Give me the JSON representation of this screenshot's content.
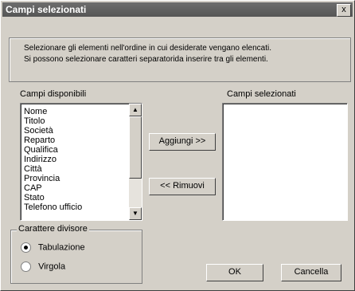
{
  "window": {
    "title": "Campi selezionati",
    "close_glyph": "x"
  },
  "info": {
    "line1": "Selezionare gli elementi nell'ordine in cui desiderate vengano elencati.",
    "line2": "Si possono selezionare caratteri separatorida inserire tra gli elementi."
  },
  "available": {
    "label": "Campi disponibili",
    "items": [
      "Nome",
      "Titolo",
      "Società",
      "Reparto",
      "Qualifica",
      "Indirizzo",
      "Città",
      "Provincia",
      "CAP",
      "Stato",
      "Telefono ufficio"
    ]
  },
  "selected": {
    "label": "Campi selezionati",
    "items": []
  },
  "buttons": {
    "add": "Aggiungi >>",
    "remove": "<< Rimuovi",
    "ok": "OK",
    "cancel": "Cancella"
  },
  "separator": {
    "title": "Carattere divisore",
    "options": [
      {
        "label": "Tabulazione",
        "selected": true
      },
      {
        "label": "Virgola",
        "selected": false
      }
    ]
  }
}
